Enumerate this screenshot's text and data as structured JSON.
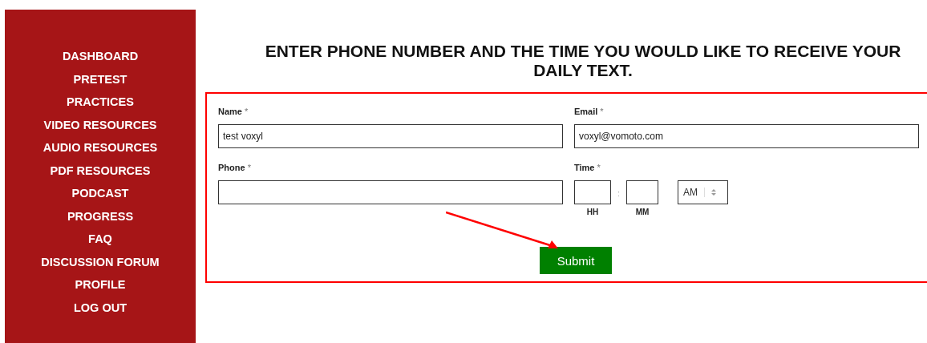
{
  "sidebar": {
    "items": [
      {
        "label": "DASHBOARD"
      },
      {
        "label": "PRETEST"
      },
      {
        "label": "PRACTICES"
      },
      {
        "label": "VIDEO RESOURCES"
      },
      {
        "label": "AUDIO RESOURCES"
      },
      {
        "label": "PDF RESOURCES"
      },
      {
        "label": "PODCAST"
      },
      {
        "label": "PROGRESS"
      },
      {
        "label": "FAQ"
      },
      {
        "label": "DISCUSSION FORUM"
      },
      {
        "label": "PROFILE"
      },
      {
        "label": "LOG OUT"
      }
    ]
  },
  "heading": "ENTER PHONE NUMBER AND THE TIME YOU WOULD LIKE TO RECEIVE YOUR DAILY TEXT.",
  "form": {
    "name": {
      "label": "Name",
      "required_mark": "*",
      "value": "test voxyl"
    },
    "email": {
      "label": "Email",
      "required_mark": "*",
      "value": "voxyl@vomoto.com"
    },
    "phone": {
      "label": "Phone",
      "required_mark": "*"
    },
    "time": {
      "label": "Time",
      "required_mark": "*",
      "separator": ":",
      "hour_label": "HH",
      "minute_label": "MM",
      "period": "AM"
    },
    "submit": "Submit"
  }
}
